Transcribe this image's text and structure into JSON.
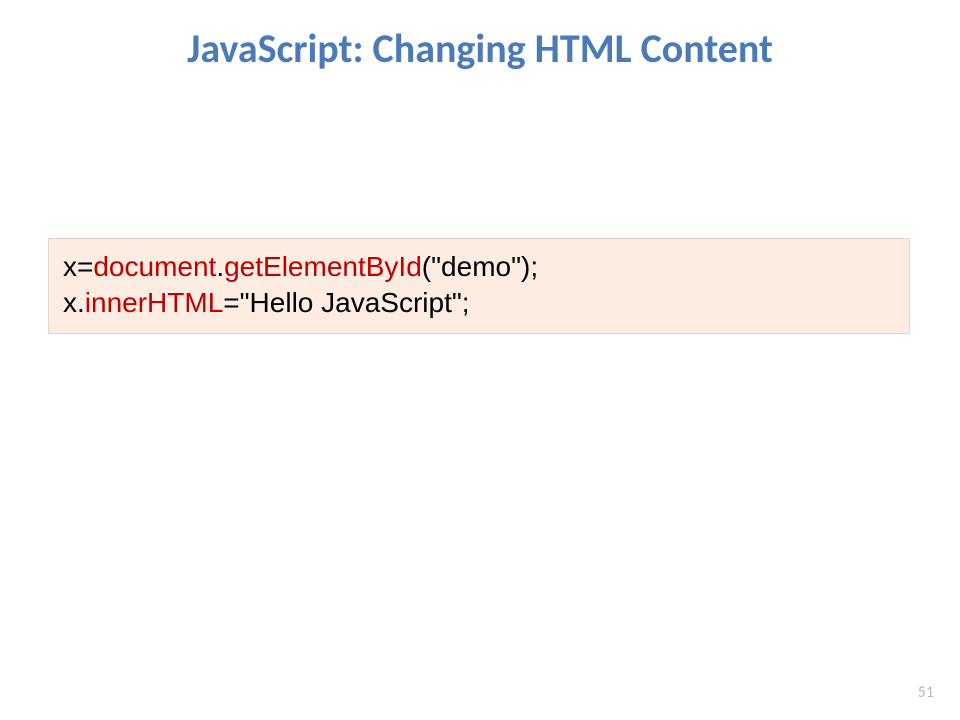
{
  "title": "JavaScript: Changing HTML Content",
  "code": {
    "line1": {
      "p1": "x=",
      "p2": "document",
      "p3": ".",
      "p4": "getElementById",
      "p5": "(\"demo\");"
    },
    "line2": {
      "p1": "x.",
      "p2": "innerHTML",
      "p3": "=\"Hello  JavaScript\";"
    }
  },
  "page_number": "51"
}
